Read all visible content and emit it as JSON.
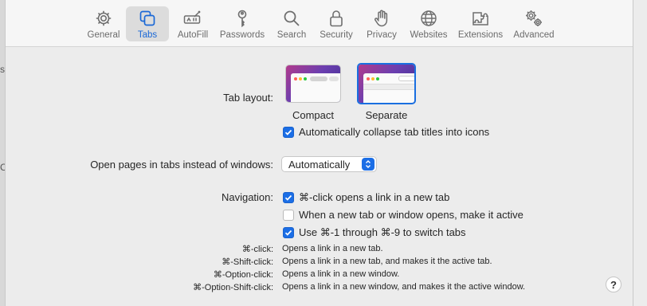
{
  "toolbar": {
    "items": [
      {
        "label": "General",
        "icon": "gear-icon",
        "selected": false
      },
      {
        "label": "Tabs",
        "icon": "tabs-icon",
        "selected": true
      },
      {
        "label": "AutoFill",
        "icon": "autofill-icon",
        "selected": false
      },
      {
        "label": "Passwords",
        "icon": "key-icon",
        "selected": false
      },
      {
        "label": "Search",
        "icon": "search-icon",
        "selected": false
      },
      {
        "label": "Security",
        "icon": "lock-icon",
        "selected": false
      },
      {
        "label": "Privacy",
        "icon": "hand-icon",
        "selected": false
      },
      {
        "label": "Websites",
        "icon": "globe-icon",
        "selected": false
      },
      {
        "label": "Extensions",
        "icon": "puzzle-icon",
        "selected": false
      },
      {
        "label": "Advanced",
        "icon": "gears-icon",
        "selected": false
      }
    ]
  },
  "tab_layout": {
    "label": "Tab layout:",
    "options": [
      {
        "label": "Compact",
        "selected": false
      },
      {
        "label": "Separate",
        "selected": true
      }
    ],
    "collapse_checkbox": {
      "label": "Automatically collapse tab titles into icons",
      "checked": true
    }
  },
  "open_pages": {
    "label": "Open pages in tabs instead of windows:",
    "value": "Automatically"
  },
  "navigation": {
    "label": "Navigation:",
    "options": [
      {
        "label": "⌘-click opens a link in a new tab",
        "checked": true
      },
      {
        "label": "When a new tab or window opens, make it active",
        "checked": false
      },
      {
        "label": "Use ⌘-1 through ⌘-9 to switch tabs",
        "checked": true
      }
    ]
  },
  "legend": [
    {
      "term": "⌘-click:",
      "desc": "Opens a link in a new tab."
    },
    {
      "term": "⌘-Shift-click:",
      "desc": "Opens a link in a new tab, and makes it the active tab."
    },
    {
      "term": "⌘-Option-click:",
      "desc": "Opens a link in a new window."
    },
    {
      "term": "⌘-Option-Shift-click:",
      "desc": "Opens a link in a new window, and makes it the active window."
    }
  ],
  "help_label": "?",
  "background_fragments": [
    "s",
    "C"
  ],
  "colors": {
    "accent": "#1b6ee6",
    "selected_label": "#1a68d6"
  }
}
